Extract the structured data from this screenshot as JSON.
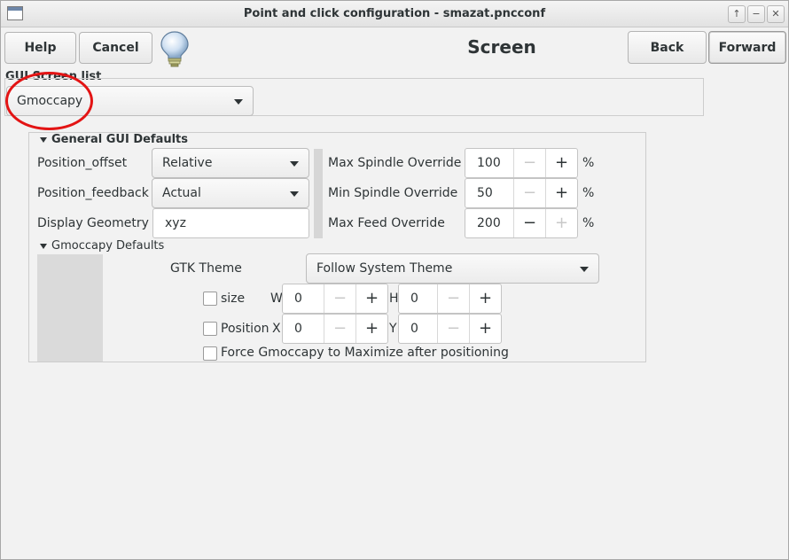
{
  "window": {
    "title": "Point and click configuration - smazat.pncconf",
    "controls": [
      "up-icon",
      "minimize-icon",
      "close-icon"
    ],
    "control_glyphs": [
      "↑",
      "−",
      "✕"
    ]
  },
  "toolbar": {
    "help_label": "Help",
    "cancel_label": "Cancel",
    "page_title": "Screen",
    "back_label": "Back",
    "forward_label": "Forward"
  },
  "gui_screen_list": {
    "label": "GUI Screen list",
    "selected": "Gmoccapy"
  },
  "general_gui_defaults": {
    "label": "General GUI Defaults",
    "position_offset_label": "Position_offset",
    "position_offset_value": "Relative",
    "position_feedback_label": "Position_feedback",
    "position_feedback_value": "Actual",
    "display_geometry_label": "Display Geometry",
    "display_geometry_value": "xyz",
    "max_spindle_label": "Max Spindle Override",
    "max_spindle_value": "100",
    "min_spindle_label": "Min Spindle Override",
    "min_spindle_value": "50",
    "max_feed_label": "Max Feed Override",
    "max_feed_value": "200",
    "unit": "%",
    "minus": "−",
    "plus": "+"
  },
  "gmoccapy_defaults": {
    "label": "Gmoccapy Defaults",
    "gtk_theme_label": "GTK Theme",
    "gtk_theme_value": "Follow System Theme",
    "size_label": "size",
    "w_label": "W",
    "w_value": "0",
    "h_label": "H",
    "h_value": "0",
    "position_label": "Position",
    "x_label": "X",
    "x_value": "0",
    "y_label": "Y",
    "y_value": "0",
    "maximize_label": "Force Gmoccapy to Maximize after positioning"
  },
  "colors": {
    "annotation_red": "#e31414",
    "background": "#f2f2f2"
  }
}
